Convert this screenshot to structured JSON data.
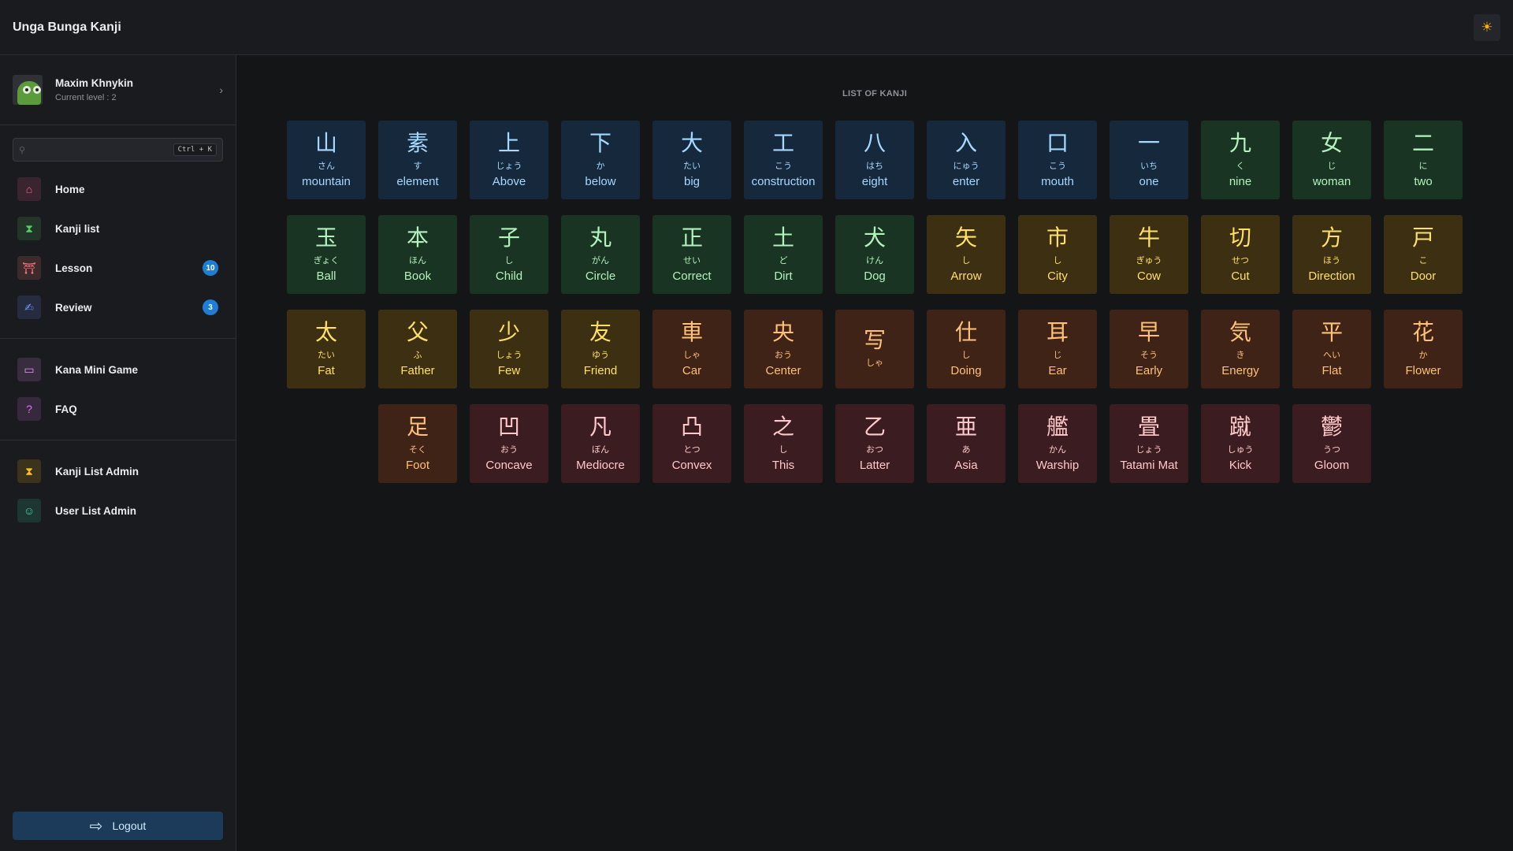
{
  "app": {
    "title": "Unga Bunga Kanji",
    "theme_icon": "sun-icon"
  },
  "user": {
    "name": "Maxim Khnykin",
    "level": "Current level : 2"
  },
  "search": {
    "placeholder": "",
    "shortcut": "Ctrl + K"
  },
  "nav": {
    "main": [
      {
        "label": "Home",
        "icon": "home-icon",
        "color": "#f06595"
      },
      {
        "label": "Kanji list",
        "icon": "hourglass-icon",
        "color": "#51cf66"
      },
      {
        "label": "Lesson",
        "icon": "torii-icon",
        "color": "#ff8787",
        "badge": "10"
      },
      {
        "label": "Review",
        "icon": "signature-icon",
        "color": "#748ffc",
        "badge": "3"
      }
    ],
    "extra": [
      {
        "label": "Kana Mini Game",
        "icon": "gamepad-icon",
        "color": "#e599f7"
      },
      {
        "label": "FAQ",
        "icon": "help-icon",
        "color": "#da77f2"
      }
    ],
    "admin": [
      {
        "label": "Kanji List Admin",
        "icon": "hourglass-icon",
        "color": "#fcc419"
      },
      {
        "label": "User List Admin",
        "icon": "users-icon",
        "color": "#38d9a9"
      }
    ]
  },
  "logout": {
    "label": "Logout"
  },
  "list": {
    "title": "LIST OF KANJI",
    "kanji": [
      {
        "k": "山",
        "r": "さん",
        "m": "mountain",
        "c": "blue"
      },
      {
        "k": "素",
        "r": "す",
        "m": "element",
        "c": "blue"
      },
      {
        "k": "上",
        "r": "じょう",
        "m": "Above",
        "c": "blue"
      },
      {
        "k": "下",
        "r": "か",
        "m": "below",
        "c": "blue"
      },
      {
        "k": "大",
        "r": "たい",
        "m": "big",
        "c": "blue"
      },
      {
        "k": "工",
        "r": "こう",
        "m": "construction",
        "c": "blue"
      },
      {
        "k": "八",
        "r": "はち",
        "m": "eight",
        "c": "blue"
      },
      {
        "k": "入",
        "r": "にゅう",
        "m": "enter",
        "c": "blue"
      },
      {
        "k": "口",
        "r": "こう",
        "m": "mouth",
        "c": "blue"
      },
      {
        "k": "一",
        "r": "いち",
        "m": "one",
        "c": "blue"
      },
      {
        "k": "九",
        "r": "く",
        "m": "nine",
        "c": "green"
      },
      {
        "k": "女",
        "r": "じ",
        "m": "woman",
        "c": "green"
      },
      {
        "k": "二",
        "r": "に",
        "m": "two",
        "c": "green"
      },
      {
        "k": "玉",
        "r": "ぎょく",
        "m": "Ball",
        "c": "green"
      },
      {
        "k": "本",
        "r": "ほん",
        "m": "Book",
        "c": "green"
      },
      {
        "k": "子",
        "r": "し",
        "m": "Child",
        "c": "green"
      },
      {
        "k": "丸",
        "r": "がん",
        "m": "Circle",
        "c": "green"
      },
      {
        "k": "正",
        "r": "せい",
        "m": "Correct",
        "c": "green"
      },
      {
        "k": "土",
        "r": "ど",
        "m": "Dirt",
        "c": "green"
      },
      {
        "k": "犬",
        "r": "けん",
        "m": "Dog",
        "c": "green"
      },
      {
        "k": "矢",
        "r": "し",
        "m": "Arrow",
        "c": "yellow"
      },
      {
        "k": "市",
        "r": "し",
        "m": "City",
        "c": "yellow"
      },
      {
        "k": "牛",
        "r": "ぎゅう",
        "m": "Cow",
        "c": "yellow"
      },
      {
        "k": "切",
        "r": "せつ",
        "m": "Cut",
        "c": "yellow"
      },
      {
        "k": "方",
        "r": "ほう",
        "m": "Direction",
        "c": "yellow"
      },
      {
        "k": "戸",
        "r": "こ",
        "m": "Door",
        "c": "yellow"
      },
      {
        "k": "太",
        "r": "たい",
        "m": "Fat",
        "c": "yellow"
      },
      {
        "k": "父",
        "r": "ふ",
        "m": "Father",
        "c": "yellow"
      },
      {
        "k": "少",
        "r": "しょう",
        "m": "Few",
        "c": "yellow"
      },
      {
        "k": "友",
        "r": "ゆう",
        "m": "Friend",
        "c": "yellow"
      },
      {
        "k": "車",
        "r": "しゃ",
        "m": "Car",
        "c": "orange"
      },
      {
        "k": "央",
        "r": "おう",
        "m": "Center",
        "c": "orange"
      },
      {
        "k": "写",
        "r": "しゃ",
        "m": "",
        "c": "orange"
      },
      {
        "k": "仕",
        "r": "し",
        "m": "Doing",
        "c": "orange"
      },
      {
        "k": "耳",
        "r": "じ",
        "m": "Ear",
        "c": "orange"
      },
      {
        "k": "早",
        "r": "そう",
        "m": "Early",
        "c": "orange"
      },
      {
        "k": "気",
        "r": "き",
        "m": "Energy",
        "c": "orange"
      },
      {
        "k": "平",
        "r": "へい",
        "m": "Flat",
        "c": "orange"
      },
      {
        "k": "花",
        "r": "か",
        "m": "Flower",
        "c": "orange"
      },
      {
        "k": "足",
        "r": "そく",
        "m": "Foot",
        "c": "orange"
      },
      {
        "k": "凹",
        "r": "おう",
        "m": "Concave",
        "c": "red"
      },
      {
        "k": "凡",
        "r": "ぼん",
        "m": "Mediocre",
        "c": "red"
      },
      {
        "k": "凸",
        "r": "とつ",
        "m": "Convex",
        "c": "red"
      },
      {
        "k": "之",
        "r": "し",
        "m": "This",
        "c": "red"
      },
      {
        "k": "乙",
        "r": "おつ",
        "m": "Latter",
        "c": "red"
      },
      {
        "k": "亜",
        "r": "あ",
        "m": "Asia",
        "c": "red"
      },
      {
        "k": "艦",
        "r": "かん",
        "m": "Warship",
        "c": "red"
      },
      {
        "k": "畳",
        "r": "じょう",
        "m": "Tatami Mat",
        "c": "red"
      },
      {
        "k": "蹴",
        "r": "しゅう",
        "m": "Kick",
        "c": "red"
      },
      {
        "k": "鬱",
        "r": "うつ",
        "m": "Gloom",
        "c": "red"
      }
    ]
  }
}
